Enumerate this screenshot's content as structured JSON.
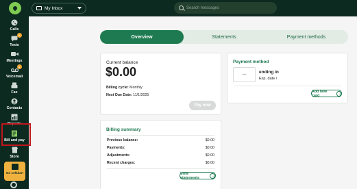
{
  "header": {
    "inbox_label": "My Inbox",
    "search_placeholder": "Search messages"
  },
  "sidebar": {
    "items": [
      {
        "label": "Calls",
        "icon": "phone-icon"
      },
      {
        "label": "Texts",
        "icon": "chat-icon",
        "badge": "1"
      },
      {
        "label": "Meetings",
        "icon": "video-icon"
      },
      {
        "label": "Voicemail",
        "icon": "voicemail-icon",
        "badge": "1"
      },
      {
        "label": "Fax",
        "icon": "fax-icon"
      },
      {
        "label": "Contacts",
        "icon": "contacts-icon"
      },
      {
        "label": "Reports",
        "icon": "chart-icon"
      },
      {
        "label": "Bill and pay",
        "icon": "bill-icon"
      },
      {
        "label": "Store",
        "icon": "store-icon"
      }
    ],
    "go_cellular": "Go cellular!"
  },
  "tabs": [
    {
      "label": "Overview",
      "active": true
    },
    {
      "label": "Statements",
      "active": false
    },
    {
      "label": "Payment methods",
      "active": false
    }
  ],
  "balance": {
    "heading": "Current balance",
    "amount": "$0.00",
    "billing_cycle_label": "Billing cycle:",
    "billing_cycle_value": "Monthly",
    "next_due_label": "Next Due Date:",
    "next_due_value": "11/1/2025",
    "pay_now": "Pay now"
  },
  "payment_method": {
    "title": "Payment method",
    "card_dash": "—",
    "ending_in": "ending in",
    "exp": "Exp. date /",
    "add_card": "Add new card"
  },
  "billing_summary": {
    "title": "Billing summary",
    "rows": [
      {
        "label": "Previous balance:",
        "value": "$0.00"
      },
      {
        "label": "Payments:",
        "value": "$0.00"
      },
      {
        "label": "Adjustments:",
        "value": "$0.00"
      },
      {
        "label": "Recent charges:",
        "value": "$0.00"
      }
    ],
    "view_statements": "View statements"
  },
  "colors": {
    "brand_dark": "#0c2a20",
    "accent_green": "#1e7a50",
    "logo_green": "#7fcb52",
    "highlight_red": "#c0161c"
  }
}
